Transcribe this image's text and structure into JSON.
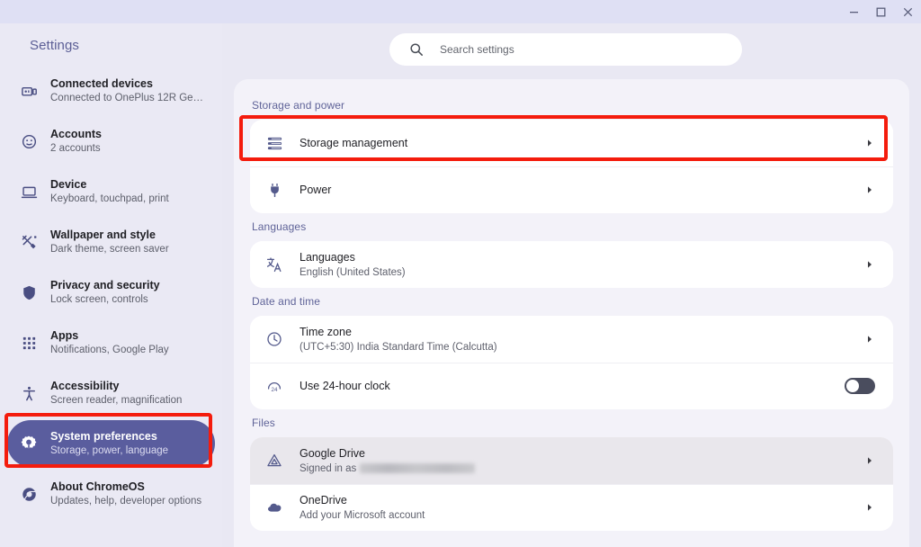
{
  "window": {
    "controls": [
      {
        "name": "minimize",
        "label": "Minimize"
      },
      {
        "name": "maximize",
        "label": "Maximize"
      },
      {
        "name": "close",
        "label": "Close"
      }
    ]
  },
  "sidebar": {
    "title": "Settings",
    "items": [
      {
        "icon": "connected-devices-icon",
        "label": "Connected devices",
        "sub": "Connected to OnePlus 12R Gens...",
        "selected": false
      },
      {
        "icon": "accounts-icon",
        "label": "Accounts",
        "sub": "2 accounts",
        "selected": false
      },
      {
        "icon": "device-icon",
        "label": "Device",
        "sub": "Keyboard, touchpad, print",
        "selected": false
      },
      {
        "icon": "wallpaper-style-icon",
        "label": "Wallpaper and style",
        "sub": "Dark theme, screen saver",
        "selected": false
      },
      {
        "icon": "privacy-security-icon",
        "label": "Privacy and security",
        "sub": "Lock screen, controls",
        "selected": false
      },
      {
        "icon": "apps-icon",
        "label": "Apps",
        "sub": "Notifications, Google Play",
        "selected": false
      },
      {
        "icon": "accessibility-icon",
        "label": "Accessibility",
        "sub": "Screen reader, magnification",
        "selected": false
      },
      {
        "icon": "system-preferences-icon",
        "label": "System preferences",
        "sub": "Storage, power, language",
        "selected": true
      },
      {
        "icon": "about-chromeos-icon",
        "label": "About ChromeOS",
        "sub": "Updates, help, developer options",
        "selected": false
      }
    ]
  },
  "search": {
    "placeholder": "Search settings",
    "value": "",
    "icon": "search-icon"
  },
  "main": {
    "sections": [
      {
        "heading": "Storage and power",
        "rows": [
          {
            "icon": "storage-icon",
            "title": "Storage management",
            "sub": "",
            "control": "chevron",
            "hovered": false
          },
          {
            "icon": "power-plug-icon",
            "title": "Power",
            "sub": "",
            "control": "chevron",
            "hovered": false
          }
        ]
      },
      {
        "heading": "Languages",
        "rows": [
          {
            "icon": "translate-icon",
            "title": "Languages",
            "sub": "English (United States)",
            "control": "chevron",
            "hovered": false
          }
        ]
      },
      {
        "heading": "Date and time",
        "rows": [
          {
            "icon": "clock-icon",
            "title": "Time zone",
            "sub": "(UTC+5:30) India Standard Time (Calcutta)",
            "control": "chevron",
            "hovered": false
          },
          {
            "icon": "clock-24h-icon",
            "title": "Use 24-hour clock",
            "sub": "",
            "control": "toggle",
            "toggle_on": false,
            "hovered": false
          }
        ]
      },
      {
        "heading": "Files",
        "rows": [
          {
            "icon": "google-drive-icon",
            "title": "Google Drive",
            "sub": "Signed in as",
            "sub_redacted": true,
            "control": "chevron",
            "hovered": true
          },
          {
            "icon": "onedrive-icon",
            "title": "OneDrive",
            "sub": "Add your Microsoft account",
            "control": "chevron",
            "hovered": false
          }
        ]
      }
    ]
  },
  "annotations": {
    "color": "#f41c0d",
    "boxes": [
      {
        "name": "highlight-storage-management",
        "target": "Storage management"
      },
      {
        "name": "highlight-system-preferences",
        "target": "System preferences"
      }
    ]
  },
  "colors": {
    "titlebar": "#dfe0f4",
    "sidebar": "#eae9f4",
    "page_background": "#e9e8f3",
    "content_card": "#f3f2f9",
    "row": "#ffffff",
    "accent": "#5a5d9e",
    "section_heading": "#5f6398",
    "annotation_red": "#f41c0d",
    "toggle_off_track": "#4a4d5e"
  }
}
